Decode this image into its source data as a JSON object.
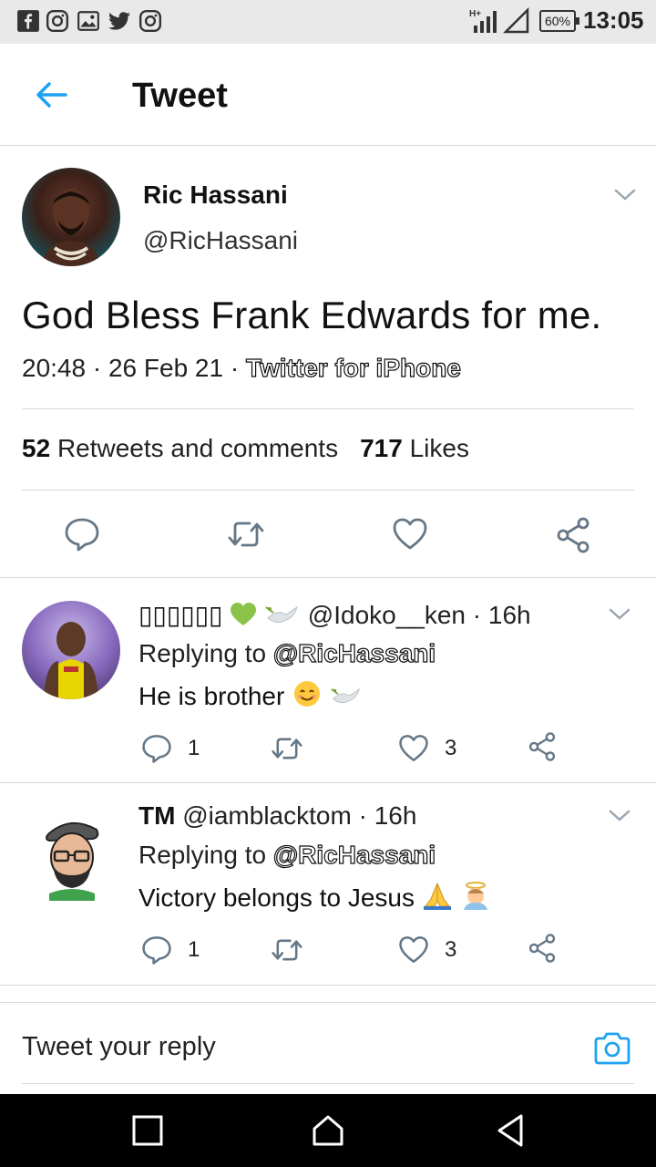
{
  "status_bar": {
    "time": "13:05",
    "battery": "60%",
    "network": "H+",
    "notification_icons": [
      "facebook-icon",
      "instagram-icon",
      "gallery-icon",
      "twitter-icon",
      "instagram-icon"
    ]
  },
  "header": {
    "title": "Tweet"
  },
  "tweet": {
    "author_name": "Ric Hassani",
    "author_handle": "@RicHassani",
    "text": "God Bless Frank Edwards for me.",
    "time": "20:48",
    "date": "26 Feb 21",
    "source": "Twitter for iPhone",
    "retweets_count": "52",
    "retweets_label": "Retweets and comments",
    "likes_count": "717",
    "likes_label": "Likes"
  },
  "replies": [
    {
      "name": "▯▯▯▯▯▯",
      "handle": "@Idoko__ken",
      "time": "16h",
      "replying_label": "Replying to",
      "replying_to": "@RicHassani",
      "text": "He is brother",
      "reply_count": "1",
      "like_count": "3"
    },
    {
      "name": "TM",
      "handle": "@iamblacktom",
      "time": "16h",
      "replying_label": "Replying to",
      "replying_to": "@RicHassani",
      "text": "Victory belongs to Jesus",
      "reply_count": "1",
      "like_count": "3"
    }
  ],
  "reply_box": {
    "placeholder": "Tweet your reply"
  },
  "colors": {
    "accent": "#1DA1F2",
    "icon": "#657786",
    "divider": "#d9d9d9"
  }
}
